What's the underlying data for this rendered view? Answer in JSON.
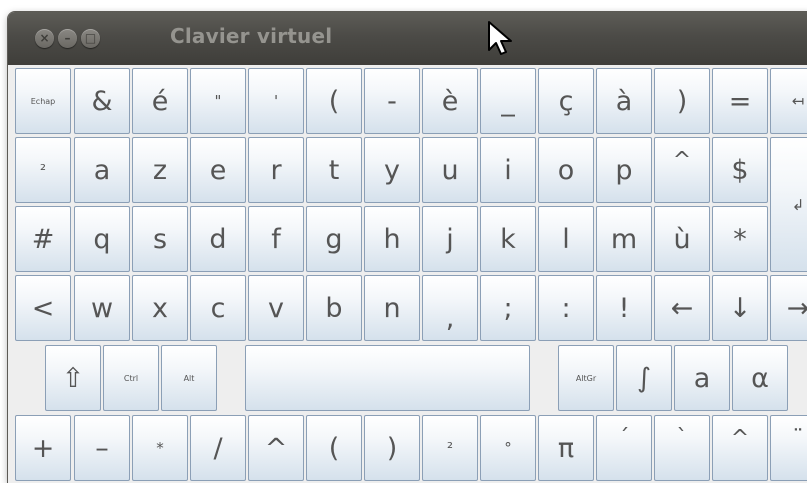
{
  "window": {
    "title": "Clavier virtuel",
    "buttons": {
      "close": "×",
      "minimize": "–",
      "maximize": "□"
    }
  },
  "keyboard": {
    "row1": [
      "Echap",
      "&",
      "é",
      "\"",
      "'",
      "(",
      "-",
      "è",
      "_",
      "ç",
      "à",
      ")",
      "=",
      "↤"
    ],
    "row2": [
      "²",
      "a",
      "z",
      "e",
      "r",
      "t",
      "y",
      "u",
      "i",
      "o",
      "p",
      "^",
      "$",
      "↲"
    ],
    "row3": [
      "#",
      "q",
      "s",
      "d",
      "f",
      "g",
      "h",
      "j",
      "k",
      "l",
      "m",
      "ù",
      "*"
    ],
    "row4": [
      "<",
      "w",
      "x",
      "c",
      "v",
      "b",
      "n",
      ",",
      ";",
      ":",
      "!",
      "←",
      "↓",
      "→"
    ],
    "row5": [
      "⇧",
      "Ctrl",
      "Alt",
      "",
      "AltGr",
      "∫",
      "a",
      "α"
    ],
    "row6": [
      "+",
      "–",
      "*",
      "/",
      "^",
      "(",
      ")",
      "²",
      "°",
      "π",
      "´",
      "`",
      "^",
      "¨"
    ]
  },
  "colors": {
    "titlebar": "#4c4b47",
    "key_border": "#8b9fb6",
    "key_text": "#555555"
  }
}
